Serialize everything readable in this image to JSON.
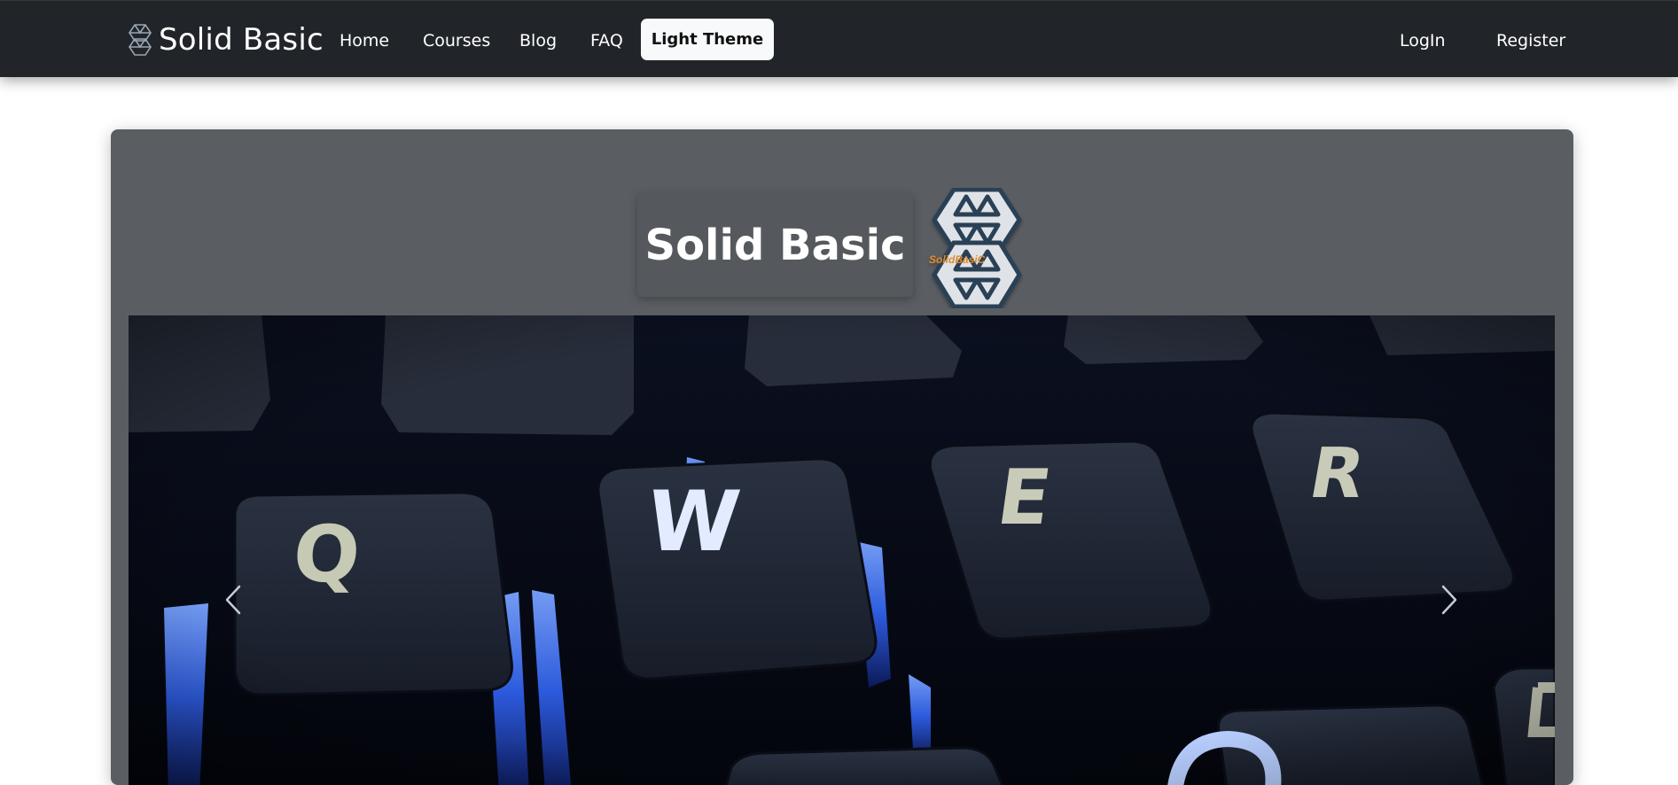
{
  "navbar": {
    "brand": "Solid Basic",
    "brand_icon": "solid-basic-logo-icon",
    "links": [
      "Home",
      "Courses",
      "Blog",
      "FAQ"
    ],
    "theme_button": "Light Theme",
    "auth": [
      "LogIn",
      "Register"
    ]
  },
  "hero": {
    "title": "Solid Basic",
    "logo_icon": "solid-basic-logo",
    "logo_text": "SolidBasiC",
    "carousel": {
      "image": "keyboard-keys-photo",
      "keys": [
        "Q",
        "W",
        "E",
        "R"
      ],
      "prev_icon": "chevron-left-icon",
      "next_icon": "chevron-right-icon"
    }
  },
  "colors": {
    "navbar_bg": "#212529",
    "hero_bg": "#5a5e62",
    "logo_stroke": "#2a3f55",
    "logo_text": "#e08a2a",
    "key_glow": "#3d74ff"
  }
}
